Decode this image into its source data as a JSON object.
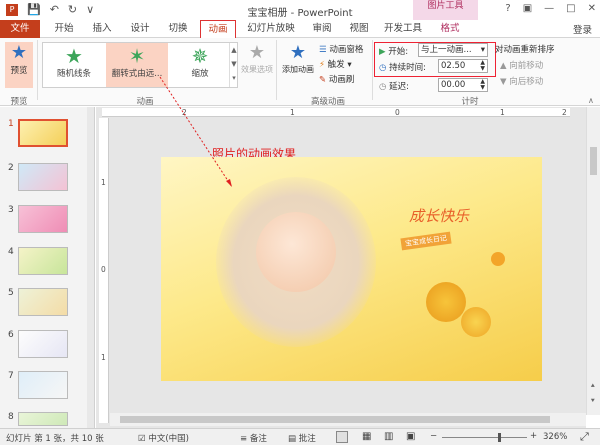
{
  "window": {
    "title": "宝宝相册 - PowerPoint",
    "contextual_tools": "图片工具"
  },
  "tabs": {
    "file": "文件",
    "home": "开始",
    "insert": "插入",
    "design": "设计",
    "transitions": "切换",
    "animations": "动画",
    "slideshow": "幻灯片放映",
    "review": "审阅",
    "view": "视图",
    "developer": "开发工具",
    "format": "格式",
    "login": "登录"
  },
  "ribbon": {
    "preview": {
      "button": "预览",
      "group": "预览"
    },
    "animation": {
      "items": [
        "随机线条",
        "翻转式由远...",
        "缩放"
      ],
      "effect_options": "效果选项",
      "group": "动画"
    },
    "advanced": {
      "add_animation": "添加动画",
      "animation_pane": "动画窗格",
      "trigger": "触发",
      "painter": "动画刷",
      "group": "高级动画"
    },
    "timing": {
      "start_label": "开始:",
      "start_value": "与上一动画...",
      "duration_label": "持续时间:",
      "duration_value": "02.50",
      "delay_label": "延迟:",
      "delay_value": "00.00",
      "reorder_title": "对动画重新排序",
      "move_earlier": "向前移动",
      "move_later": "向后移动",
      "group": "计时"
    }
  },
  "ruler": {
    "h": [
      "2",
      "1",
      "0",
      "1",
      "2"
    ],
    "v": [
      "1",
      "0",
      "1"
    ]
  },
  "annotation": "照片的动画效果",
  "slide": {
    "calligraphy": "成长快乐",
    "subtitle": "宝宝成长日记"
  },
  "thumbnails": [
    "1",
    "2",
    "3",
    "4",
    "5",
    "6",
    "7",
    "8"
  ],
  "status": {
    "slide_info": "幻灯片 第 1 张，共 10 张",
    "language": "中文(中国)",
    "notes": "备注",
    "comments": "批注",
    "zoom": "326%"
  },
  "colors": {
    "accent": "#c43e1c",
    "highlight": "#e02020",
    "contextual": "#b03060"
  }
}
